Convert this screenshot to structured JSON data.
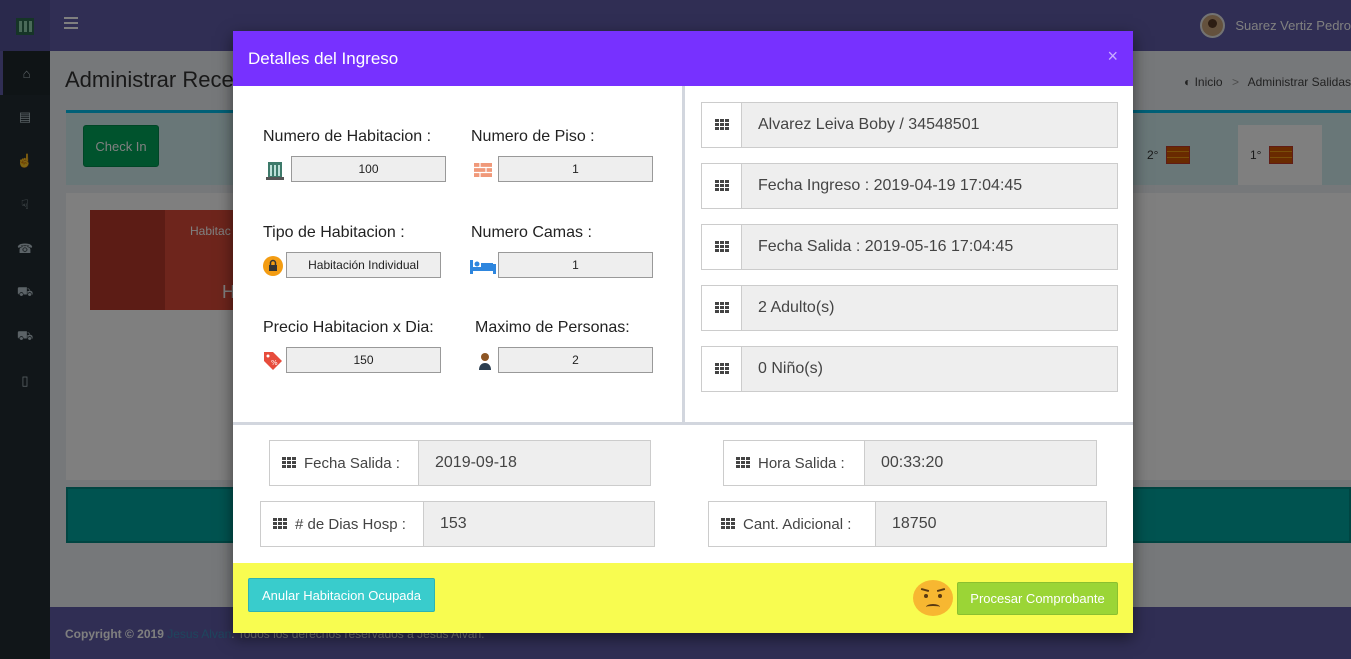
{
  "app": {
    "user_name": "Suarez Vertiz Pedro",
    "page_title": "Administrar Rece",
    "breadcrumb": [
      "Inicio",
      "Administrar Salidas"
    ],
    "checkin_label": "Check In",
    "floors": [
      "2°",
      "1°"
    ],
    "room_card_label": "Habitac",
    "room_card_letter": "H",
    "footer": {
      "copyright": "Copyright © 2019",
      "author": "Jesus Alvan",
      "rights": ". Todos los derechos reservados a Jesus Alvan."
    }
  },
  "modal": {
    "title": "Detalles del Ingreso",
    "close_glyph": "×",
    "room": {
      "numero_habitacion_label": "Numero de Habitacion :",
      "numero_habitacion": "100",
      "numero_piso_label": "Numero de Piso :",
      "numero_piso": "1",
      "tipo_habitacion_label": "Tipo de Habitacion :",
      "tipo_habitacion": "Habitación Individual",
      "numero_camas_label": "Numero Camas :",
      "numero_camas": "1",
      "precio_label": "Precio Habitacion x Dia:",
      "precio": "150",
      "max_personas_label": "Maximo de Personas:",
      "max_personas": "2"
    },
    "guest": {
      "cliente": "Alvarez Leiva Boby / 34548501",
      "fecha_ingreso": "Fecha Ingreso : 2019-04-19 17:04:45",
      "fecha_salida": "Fecha Salida : 2019-05-16 17:04:45",
      "adultos": "2 Adulto(s)",
      "ninos": "0 Niño(s)"
    },
    "checkout": {
      "fecha_salida_label": "Fecha Salida :",
      "fecha_salida": "2019-09-18",
      "hora_salida_label": "Hora Salida :",
      "hora_salida": "00:33:20",
      "dias_label": "# de Dias Hosp :",
      "dias": "153",
      "cant_adicional_label": "Cant. Adicional :",
      "cant_adicional": "18750"
    },
    "buttons": {
      "anular": "Anular Habitacion Ocupada",
      "procesar": "Procesar Comprobante"
    }
  }
}
